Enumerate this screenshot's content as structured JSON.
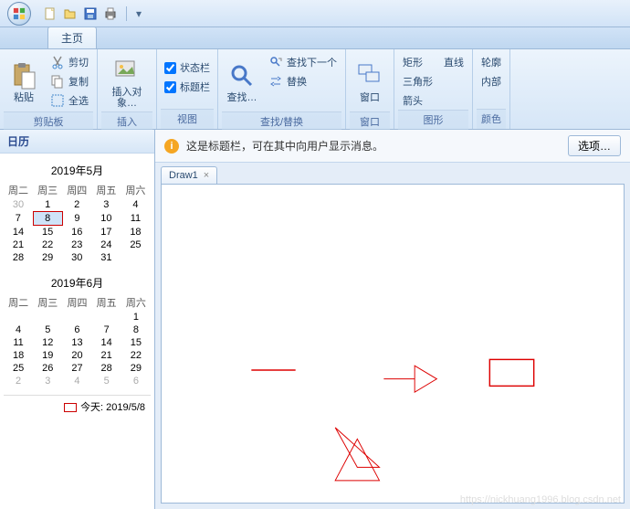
{
  "qat": {
    "new": "新建",
    "open": "打开",
    "save": "保存",
    "print": "打印"
  },
  "tabs": {
    "home": "主页"
  },
  "ribbon": {
    "clipboard": {
      "label": "剪贴板",
      "paste": "粘贴",
      "cut": "剪切",
      "copy": "复制",
      "selectAll": "全选"
    },
    "insert": {
      "label": "插入",
      "insertObj": "插入对象…"
    },
    "view": {
      "label": "视图",
      "statusbar": "状态栏",
      "titlebar": "标题栏"
    },
    "findrep": {
      "label": "查找/替换",
      "find": "查找…",
      "findNext": "查找下一个",
      "replace": "替换"
    },
    "window": {
      "label": "窗口",
      "btn": "窗口"
    },
    "shapes": {
      "label": "图形",
      "rect": "矩形",
      "line": "直线",
      "triangle": "三角形",
      "arrow": "箭头"
    },
    "color": {
      "label": "颜色",
      "outline": "轮廓",
      "fill": "内部"
    }
  },
  "sidebar": {
    "title": "日历"
  },
  "info": {
    "msg": "这是标题栏，可在其中向用户显示消息。",
    "options": "选项…"
  },
  "doc": {
    "tab1": "Draw1"
  },
  "cal1": {
    "title": "2019年5月",
    "dow": [
      "周二",
      "周三",
      "周四",
      "周五",
      "周六"
    ],
    "rows": [
      [
        {
          "d": "30",
          "dim": true
        },
        {
          "d": "1"
        },
        {
          "d": "2"
        },
        {
          "d": "3"
        },
        {
          "d": "4"
        }
      ],
      [
        {
          "d": "7"
        },
        {
          "d": "8",
          "today": true
        },
        {
          "d": "9"
        },
        {
          "d": "10"
        },
        {
          "d": "11"
        }
      ],
      [
        {
          "d": "14"
        },
        {
          "d": "15"
        },
        {
          "d": "16"
        },
        {
          "d": "17"
        },
        {
          "d": "18"
        }
      ],
      [
        {
          "d": "21"
        },
        {
          "d": "22"
        },
        {
          "d": "23"
        },
        {
          "d": "24"
        },
        {
          "d": "25"
        }
      ],
      [
        {
          "d": "28"
        },
        {
          "d": "29"
        },
        {
          "d": "30"
        },
        {
          "d": "31"
        },
        {
          "d": ""
        }
      ]
    ]
  },
  "cal2": {
    "title": "2019年6月",
    "dow": [
      "周二",
      "周三",
      "周四",
      "周五",
      "周六"
    ],
    "rows": [
      [
        {
          "d": ""
        },
        {
          "d": ""
        },
        {
          "d": ""
        },
        {
          "d": ""
        },
        {
          "d": "1"
        }
      ],
      [
        {
          "d": "4"
        },
        {
          "d": "5"
        },
        {
          "d": "6"
        },
        {
          "d": "7"
        },
        {
          "d": "8"
        }
      ],
      [
        {
          "d": "11"
        },
        {
          "d": "12"
        },
        {
          "d": "13"
        },
        {
          "d": "14"
        },
        {
          "d": "15"
        }
      ],
      [
        {
          "d": "18"
        },
        {
          "d": "19"
        },
        {
          "d": "20"
        },
        {
          "d": "21"
        },
        {
          "d": "22"
        }
      ],
      [
        {
          "d": "25"
        },
        {
          "d": "26"
        },
        {
          "d": "27"
        },
        {
          "d": "28"
        },
        {
          "d": "29"
        }
      ],
      [
        {
          "d": "2",
          "dim": true
        },
        {
          "d": "3",
          "dim": true
        },
        {
          "d": "4",
          "dim": true
        },
        {
          "d": "5",
          "dim": true
        },
        {
          "d": "6",
          "dim": true
        }
      ]
    ]
  },
  "today": {
    "label": "今天: 2019/5/8"
  },
  "watermark": "https://nickhuang1996.blog.csdn.net"
}
